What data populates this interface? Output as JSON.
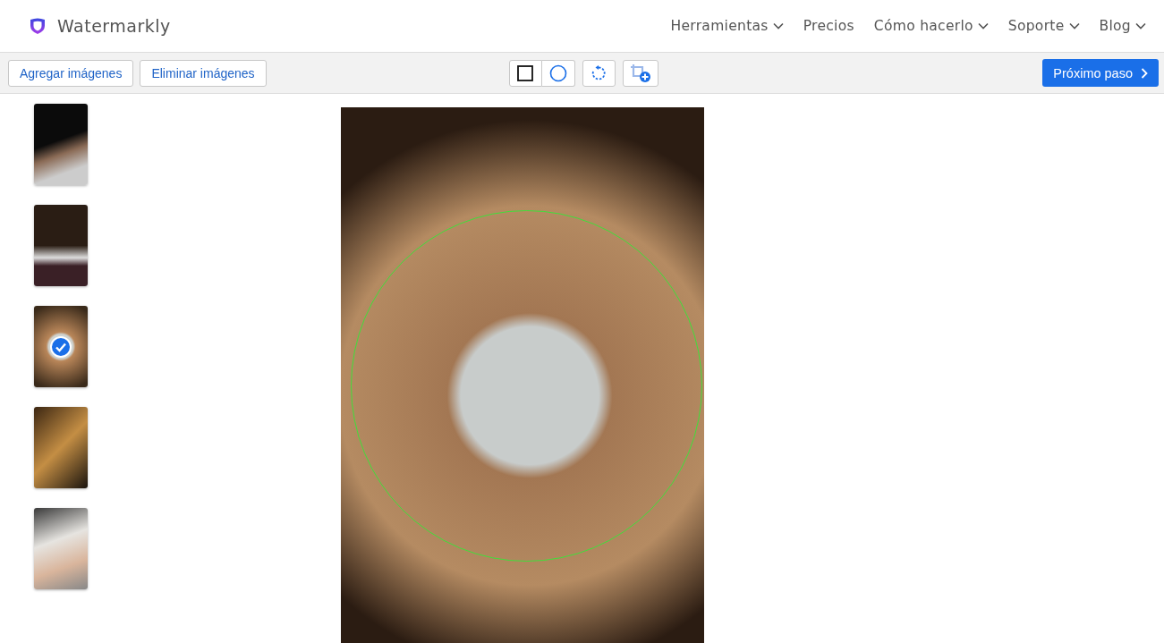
{
  "brand": {
    "name": "Watermarkly"
  },
  "nav": [
    {
      "label": "Herramientas",
      "has_menu": true
    },
    {
      "label": "Precios",
      "has_menu": false
    },
    {
      "label": "Cómo hacerlo",
      "has_menu": true
    },
    {
      "label": "Soporte",
      "has_menu": true
    },
    {
      "label": "Blog",
      "has_menu": true
    }
  ],
  "toolbar": {
    "left_buttons": [
      "Agregar imágenes",
      "Eliminar imágenes"
    ],
    "tools": [
      {
        "kind": "square"
      },
      {
        "kind": "circle"
      },
      {
        "kind": "rotate"
      },
      {
        "kind": "add-crop"
      }
    ],
    "next_button": "Próximo paso"
  },
  "thumbnails": [
    {
      "selected": false
    },
    {
      "selected": false
    },
    {
      "selected": true
    },
    {
      "selected": false
    },
    {
      "selected": false
    }
  ]
}
